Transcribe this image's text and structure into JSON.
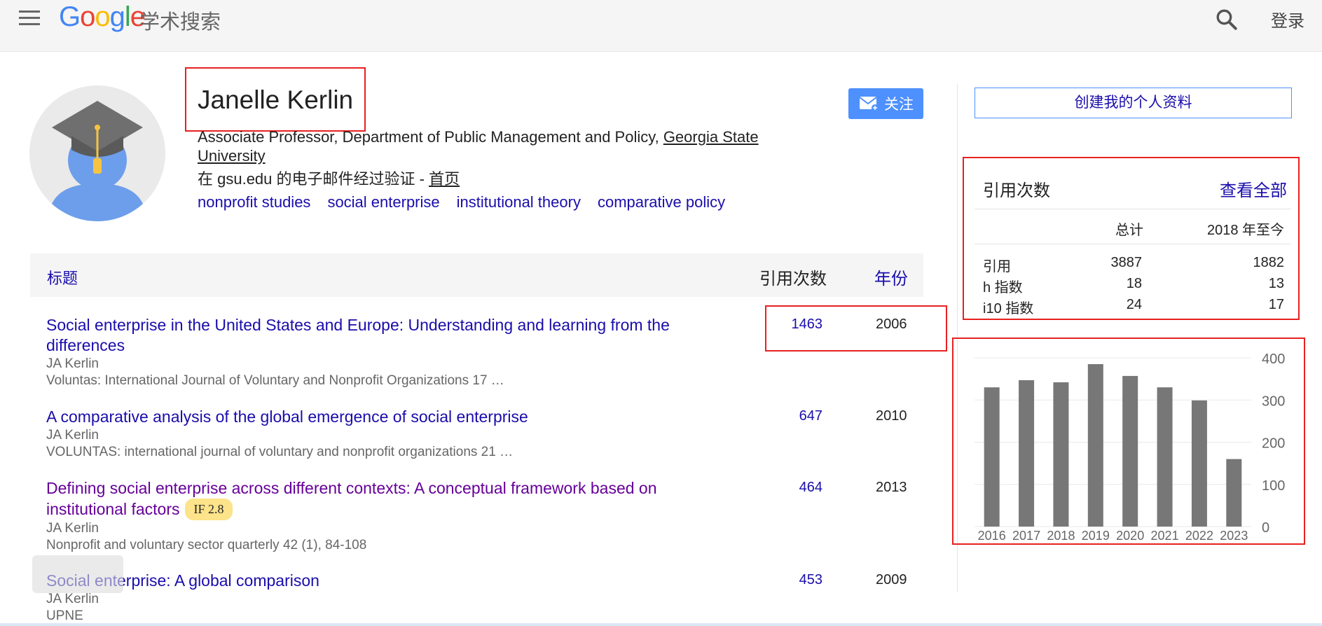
{
  "header": {
    "logo_letters": [
      "G",
      "o",
      "o",
      "g",
      "l",
      "e"
    ],
    "logo_sub": "学术搜索",
    "login": "登录"
  },
  "profile": {
    "name": "Janelle Kerlin",
    "affiliation_prefix": "Associate Professor, Department of Public Management and Policy, ",
    "affiliation_link": "Georgia State University",
    "verified_prefix": "在 gsu.edu 的电子邮件经过验证 - ",
    "homepage": "首页",
    "interests": [
      "nonprofit studies",
      "social enterprise",
      "institutional theory",
      "comparative policy"
    ],
    "follow": "关注"
  },
  "table": {
    "header_title": "标题",
    "header_cites": "引用次数",
    "header_year": "年份",
    "rows": [
      {
        "title": "Social enterprise in the United States and Europe: Understanding and learning from the differences",
        "authors": "JA Kerlin",
        "venue": "Voluntas: International Journal of Voluntary and Nonprofit Organizations 17 …",
        "cites": "1463",
        "year": "2006"
      },
      {
        "title": "A comparative analysis of the global emergence of social enterprise",
        "authors": "JA Kerlin",
        "venue": "VOLUNTAS: international journal of voluntary and nonprofit organizations 21 …",
        "cites": "647",
        "year": "2010"
      },
      {
        "title": "Defining social enterprise across different contexts: A conceptual framework based on institutional factors",
        "badge": "IF 2.8",
        "authors": "JA Kerlin",
        "venue": "Nonprofit and voluntary sector quarterly 42 (1), 84-108",
        "cites": "464",
        "year": "2013"
      },
      {
        "title": "Social enterprise: A global comparison",
        "authors": "JA Kerlin",
        "venue": "UPNE",
        "cites": "453",
        "year": "2009"
      }
    ]
  },
  "sidebar": {
    "create_profile": "创建我的个人资料",
    "stats_title": "引用次数",
    "view_all": "查看全部",
    "col_total": "总计",
    "col_since": "2018 年至今",
    "rows": [
      {
        "label": "引用",
        "total": "3887",
        "since": "1882"
      },
      {
        "label": "h 指数",
        "total": "18",
        "since": "13"
      },
      {
        "label": "i10 指数",
        "total": "24",
        "since": "17"
      }
    ]
  },
  "chart_data": {
    "type": "bar",
    "categories": [
      "2016",
      "2017",
      "2018",
      "2019",
      "2020",
      "2021",
      "2022",
      "2023"
    ],
    "values": [
      330,
      347,
      342,
      385,
      357,
      330,
      299,
      160
    ],
    "yticks": [
      0,
      100,
      200,
      300,
      400
    ],
    "ylim": [
      0,
      400
    ],
    "grid": true,
    "bar_color": "#777777"
  },
  "colors": {
    "link": "#1a0dab",
    "visited": "#660099",
    "highlight_box": "#e82020",
    "button_blue": "#4d90fe"
  }
}
